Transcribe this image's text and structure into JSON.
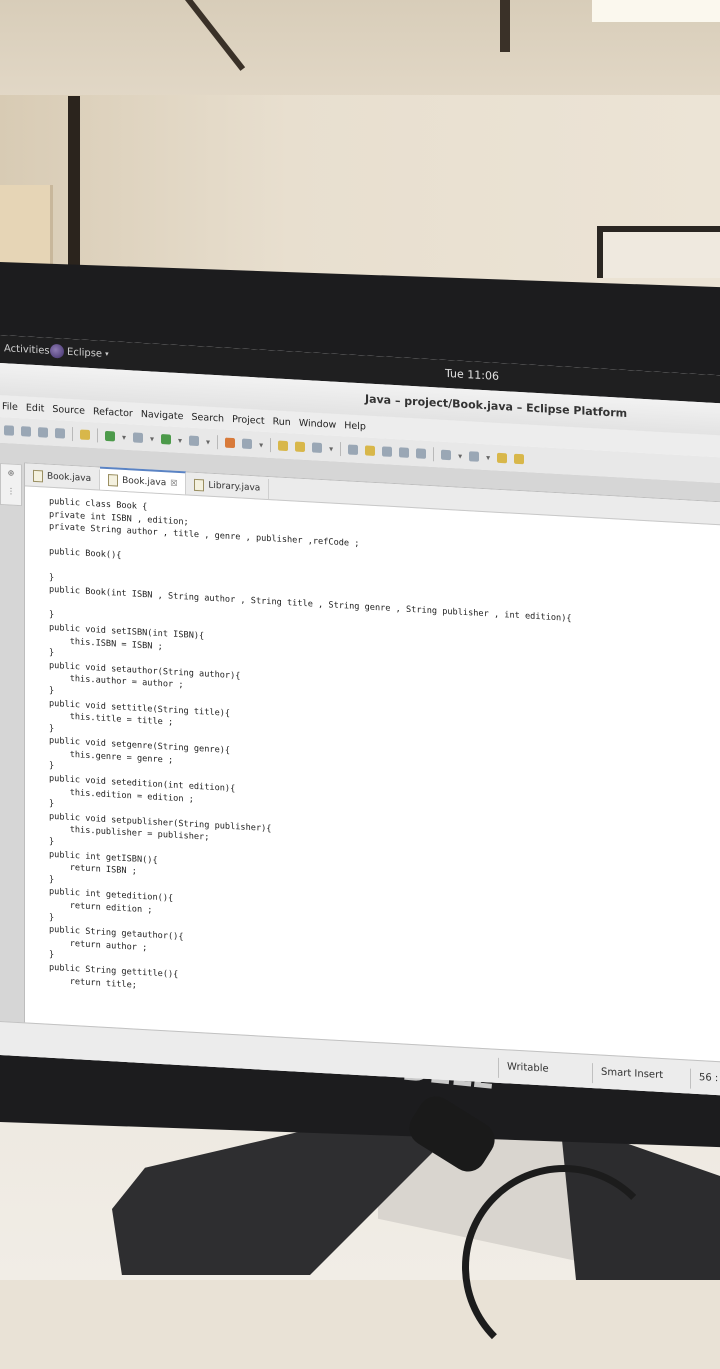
{
  "topbar": {
    "activities": "Activities",
    "app_menu": "Eclipse",
    "clock": "Tue 11:06"
  },
  "window": {
    "title": "Java – project/Book.java – Eclipse Platform"
  },
  "menubar": [
    "File",
    "Edit",
    "Source",
    "Refactor",
    "Navigate",
    "Search",
    "Project",
    "Run",
    "Window",
    "Help"
  ],
  "tabs": [
    {
      "label": "Book.java",
      "active": false
    },
    {
      "label": "Book.java",
      "active": true,
      "close": "☒"
    },
    {
      "label": "Library.java",
      "active": false
    }
  ],
  "code_lines": [
    "public class Book {",
    "private int ISBN , edition;",
    "private String author , title , genre , publisher ,refCode ;",
    "",
    "public Book(){",
    "",
    "}",
    "public Book(int ISBN , String author , String title , String genre , String publisher , int edition){",
    "",
    "}",
    "public void setISBN(int ISBN){",
    "    this.ISBN = ISBN ;",
    "}",
    "public void setauthor(String author){",
    "    this.author = author ;",
    "}",
    "public void settitle(String title){",
    "    this.title = title ;",
    "}",
    "public void setgenre(String genre){",
    "    this.genre = genre ;",
    "}",
    "public void setedition(int edition){",
    "    this.edition = edition ;",
    "}",
    "public void setpublisher(String publisher){",
    "    this.publisher = publisher;",
    "}",
    "public int getISBN(){",
    "    return ISBN ;",
    "}",
    "public int getedition(){",
    "    return edition ;",
    "}",
    "public String getauthor(){",
    "    return author ;",
    "}",
    "public String gettitle(){",
    "    return title;"
  ],
  "status": {
    "writable": "Writable",
    "insert_mode": "Smart Insert",
    "position": "56 :"
  },
  "bezel": {
    "logo": "DELL"
  }
}
